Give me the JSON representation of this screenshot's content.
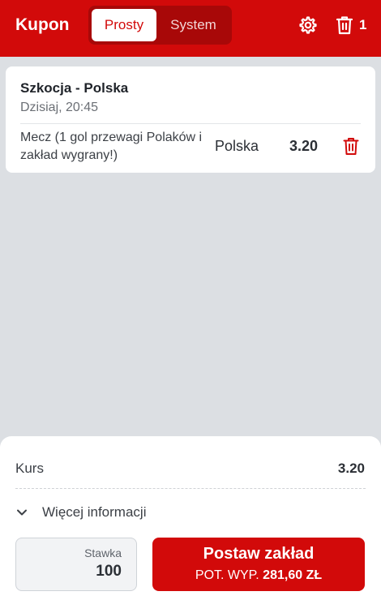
{
  "header": {
    "title": "Kupon",
    "tabs": [
      {
        "label": "Prosty",
        "active": true
      },
      {
        "label": "System",
        "active": false
      }
    ],
    "settings_icon": "gear-icon",
    "trash_icon": "trash-icon",
    "selection_count": "1",
    "brand_color": "#d20a0a"
  },
  "bet": {
    "match": "Szkocja - Polska",
    "datetime": "Dzisiaj, 20:45",
    "market": "Mecz (1 gol przewagi Polaków i zakład wygrany!)",
    "pick": "Polska",
    "odd": "3.20",
    "remove_icon": "trash-icon"
  },
  "summary": {
    "kurs_label": "Kurs",
    "kurs_value": "3.20",
    "more_info_label": "Więcej informacji",
    "stake_label": "Stawka",
    "stake_value": "100",
    "place_bet_label": "Postaw zakład",
    "potential_win_label": "POT. WYP.",
    "potential_win_value": "281,60 ZŁ"
  }
}
